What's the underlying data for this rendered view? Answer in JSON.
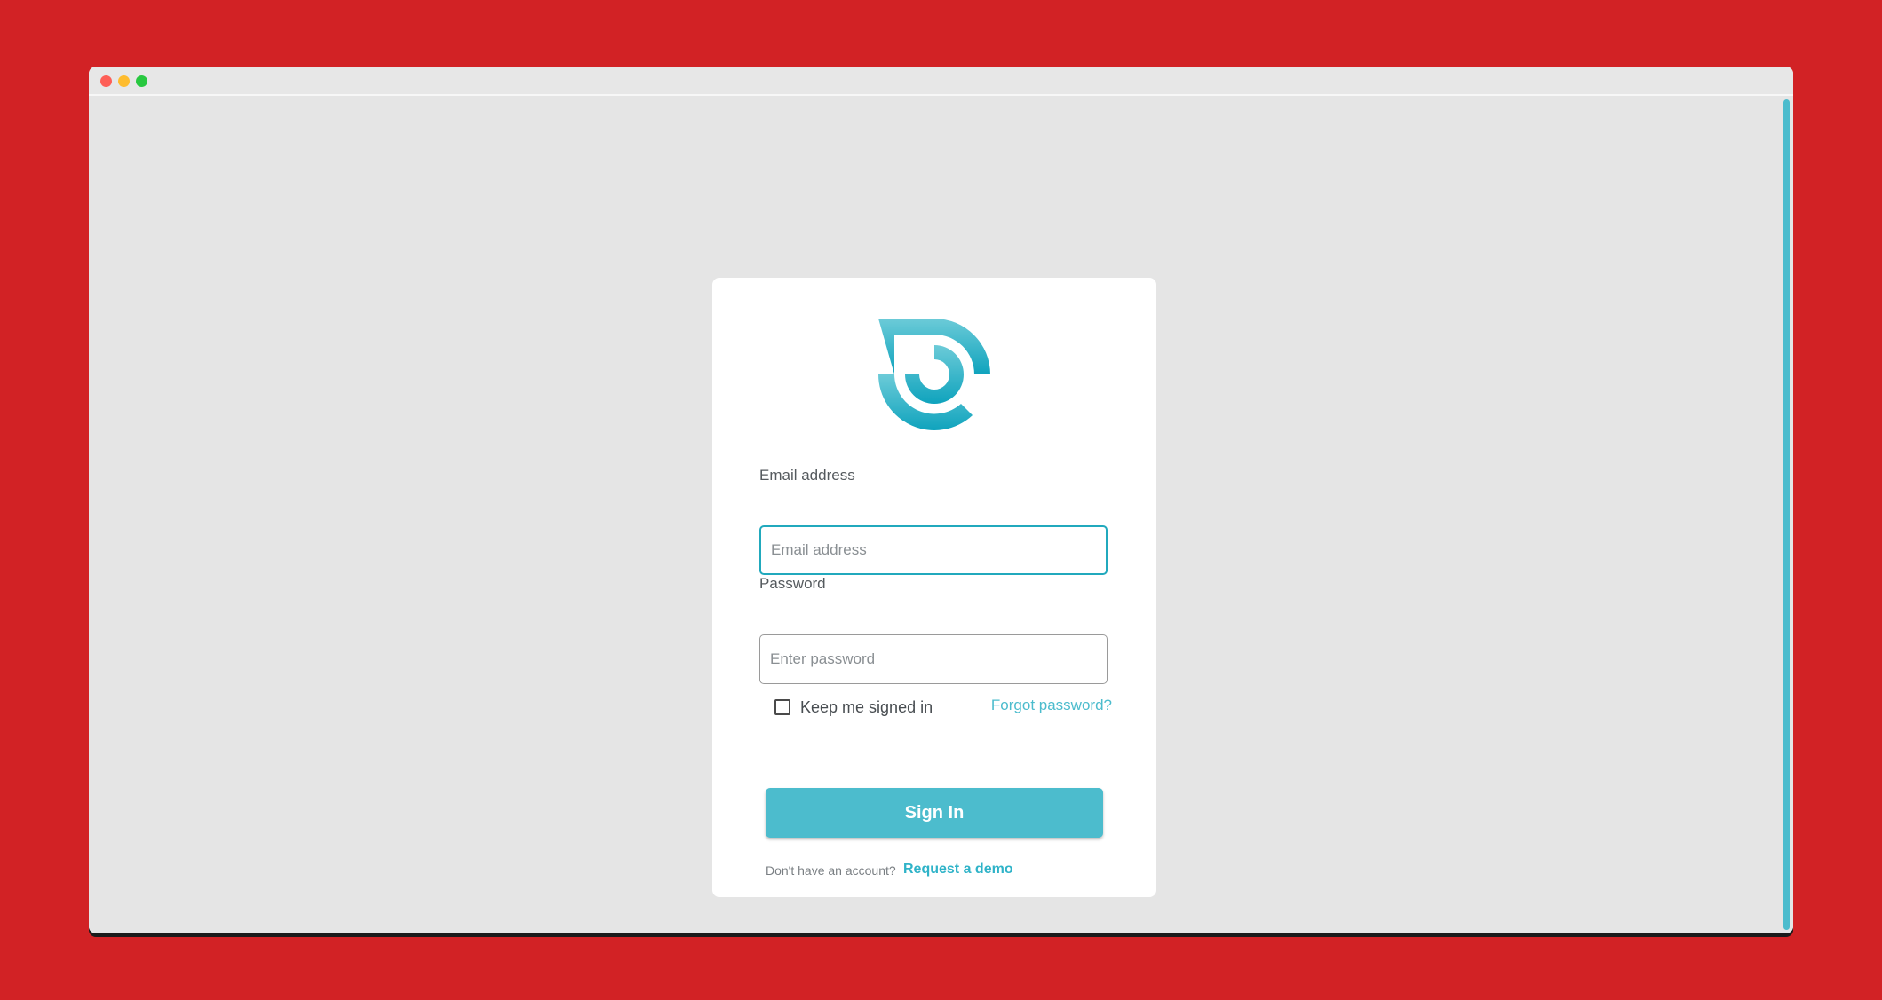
{
  "window": {
    "controls": [
      "close",
      "minimize",
      "maximize"
    ]
  },
  "logo": {
    "icon": "brand-logo-icon",
    "colors": {
      "top": "#6ccbd8",
      "bottom": "#0fa3bd"
    }
  },
  "form": {
    "email": {
      "label": "Email address",
      "placeholder": "Email address",
      "value": ""
    },
    "password": {
      "label": "Password",
      "placeholder": "Enter password",
      "value": ""
    },
    "keep_signed_in": {
      "label": "Keep me signed in",
      "checked": false
    },
    "forgot_password": "Forgot password?",
    "submit_label": "Sign In",
    "no_account_text": "Don't have an account?",
    "request_demo": "Request a demo"
  },
  "colors": {
    "background": "#d22225",
    "accent": "#4cbccd",
    "focus_border": "#21a9bd"
  }
}
